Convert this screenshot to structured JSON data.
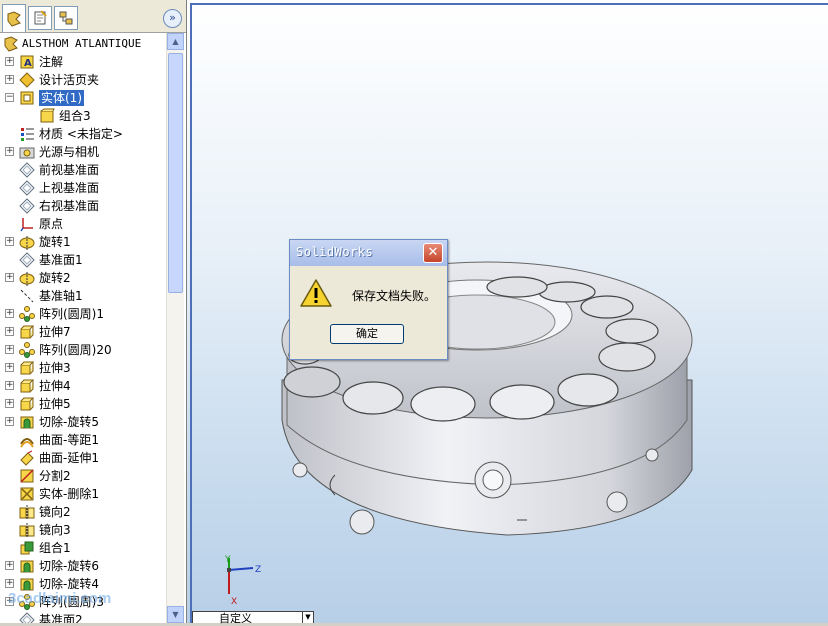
{
  "panel_tabs": [
    "feature-manager",
    "property-manager",
    "configuration-manager"
  ],
  "tree": {
    "root": "ALSTHOM ATLANTIQUE",
    "items": [
      {
        "label": "注解",
        "icon": "annotation-icon",
        "expand": "+"
      },
      {
        "label": "设计活页夹",
        "icon": "design-binder-icon",
        "expand": "+"
      },
      {
        "label": "实体(1)",
        "icon": "solid-bodies-icon",
        "expand": "-",
        "selected": true
      },
      {
        "label": "组合3",
        "icon": "body-icon",
        "indent": 1
      },
      {
        "label": "材质 <未指定>",
        "icon": "material-icon"
      },
      {
        "label": "光源与相机",
        "icon": "lights-camera-icon",
        "expand": "+"
      },
      {
        "label": "前视基准面",
        "icon": "plane-icon"
      },
      {
        "label": "上视基准面",
        "icon": "plane-icon"
      },
      {
        "label": "右视基准面",
        "icon": "plane-icon"
      },
      {
        "label": "原点",
        "icon": "origin-icon"
      },
      {
        "label": "旋转1",
        "icon": "revolve-icon",
        "expand": "+"
      },
      {
        "label": "基准面1",
        "icon": "plane-icon"
      },
      {
        "label": "旋转2",
        "icon": "revolve-icon",
        "expand": "+"
      },
      {
        "label": "基准轴1",
        "icon": "axis-icon"
      },
      {
        "label": "阵列(圆周)1",
        "icon": "circular-pattern-icon",
        "expand": "+"
      },
      {
        "label": "拉伸7",
        "icon": "extrude-icon",
        "expand": "+"
      },
      {
        "label": "阵列(圆周)20",
        "icon": "circular-pattern-icon",
        "expand": "+"
      },
      {
        "label": "拉伸3",
        "icon": "extrude-icon",
        "expand": "+"
      },
      {
        "label": "拉伸4",
        "icon": "extrude-icon",
        "expand": "+"
      },
      {
        "label": "拉伸5",
        "icon": "extrude-icon",
        "expand": "+"
      },
      {
        "label": "切除-旋转5",
        "icon": "cut-revolve-icon",
        "expand": "+"
      },
      {
        "label": "曲面-等距1",
        "icon": "offset-surface-icon"
      },
      {
        "label": "曲面-延伸1",
        "icon": "extend-surface-icon"
      },
      {
        "label": "分割2",
        "icon": "split-icon"
      },
      {
        "label": "实体-删除1",
        "icon": "delete-body-icon"
      },
      {
        "label": "镜向2",
        "icon": "mirror-icon"
      },
      {
        "label": "镜向3",
        "icon": "mirror-icon"
      },
      {
        "label": "组合1",
        "icon": "combine-icon"
      },
      {
        "label": "切除-旋转6",
        "icon": "cut-revolve-icon",
        "expand": "+"
      },
      {
        "label": "切除-旋转4",
        "icon": "cut-revolve-icon",
        "expand": "+"
      },
      {
        "label": "阵列(圆周)3",
        "icon": "circular-pattern-icon",
        "expand": "+"
      },
      {
        "label": "基准面2",
        "icon": "plane-icon"
      }
    ]
  },
  "dialog": {
    "title": "SolidWorks",
    "message": "保存文档失败。",
    "ok_label": "确定"
  },
  "viewport": {
    "tab_label": "自定义",
    "triad": {
      "x": "X",
      "y": "Y",
      "z": "Z"
    }
  },
  "watermark": "3cadlaimi.com",
  "colors": {
    "selection": "#316ac5",
    "dialog_title": "#a7bde8",
    "close_button": "#c5452b",
    "viewport_top": "#ffffff",
    "viewport_bottom": "#b7cfe7"
  }
}
